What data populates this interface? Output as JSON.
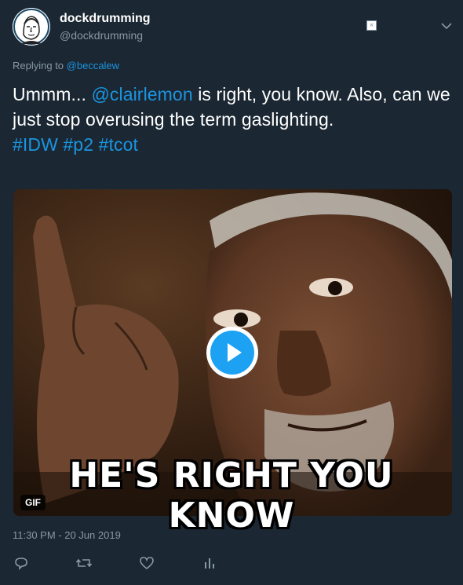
{
  "user": {
    "display_name": "dockdrumming",
    "handle": "@dockdrumming"
  },
  "reply": {
    "prefix": "Replying to ",
    "to": "@beccalew"
  },
  "tweet": {
    "part1": "Ummm... ",
    "mention": "@clairlemon",
    "part2": " is right, you know. Also, can we just stop overusing the term gaslighting.",
    "hashtags": [
      "#IDW",
      "#p2",
      "#tcot"
    ]
  },
  "media": {
    "caption": "HE'S RIGHT YOU KNOW",
    "badge": "GIF"
  },
  "timestamp": "11:30 PM - 20 Jun 2019",
  "icons": {
    "reply": "reply-icon",
    "retweet": "retweet-icon",
    "like": "heart-icon",
    "analytics": "analytics-icon",
    "more": "chevron-down-icon",
    "play": "play-icon"
  },
  "colors": {
    "background": "#1b2733",
    "link": "#1b95e0",
    "secondary_text": "#8899a6",
    "play_button": "#1da1f2"
  }
}
